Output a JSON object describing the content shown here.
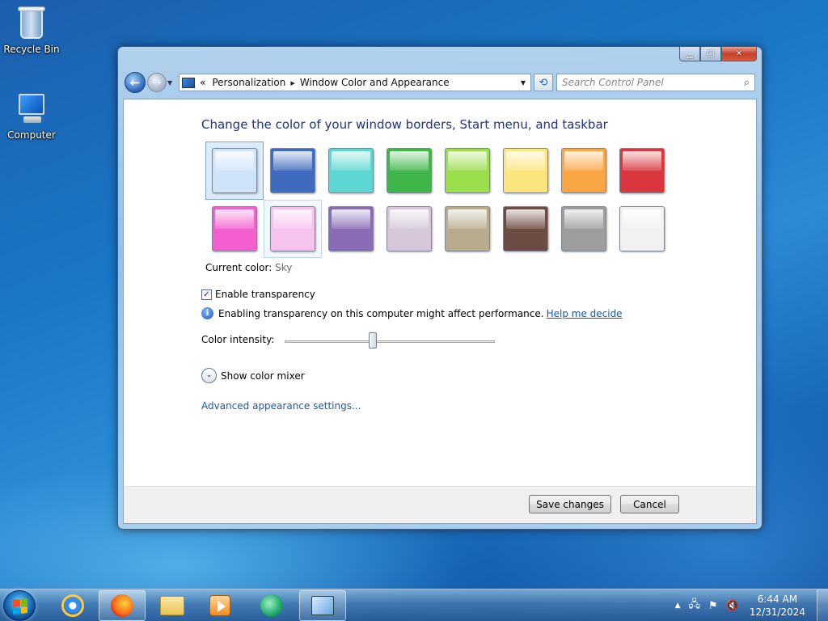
{
  "desktop": {
    "icons": [
      {
        "label": "Recycle Bin"
      },
      {
        "label": "Computer"
      }
    ]
  },
  "window": {
    "address": {
      "crumbs": [
        "Personalization",
        "Window Color and Appearance"
      ],
      "lead_sep": "«",
      "sep": "▸"
    },
    "search": {
      "placeholder": "Search Control Panel"
    },
    "heading": "Change the color of your window borders, Start menu, and taskbar",
    "colors": [
      {
        "name": "Sky",
        "hex": "#cfe4fb"
      },
      {
        "name": "Twilight",
        "hex": "#3f6bbf"
      },
      {
        "name": "Sea",
        "hex": "#5cd6d0"
      },
      {
        "name": "Leaf",
        "hex": "#3fb64a"
      },
      {
        "name": "Lime",
        "hex": "#9ade4c"
      },
      {
        "name": "Lemon",
        "hex": "#fbe57c"
      },
      {
        "name": "Pumpkin",
        "hex": "#fba645"
      },
      {
        "name": "Ruby",
        "hex": "#d9373d"
      },
      {
        "name": "Fuchsia",
        "hex": "#f45fcf"
      },
      {
        "name": "Blush",
        "hex": "#f6c3ef"
      },
      {
        "name": "Violet",
        "hex": "#8a6bb6"
      },
      {
        "name": "Lavender",
        "hex": "#d6c7da"
      },
      {
        "name": "Taupe",
        "hex": "#b8ab8e"
      },
      {
        "name": "Chocolate",
        "hex": "#6d4a42"
      },
      {
        "name": "Slate",
        "hex": "#9d9d9d"
      },
      {
        "name": "Frost",
        "hex": "#f1f1f1"
      }
    ],
    "current_color": {
      "label": "Current color:",
      "value": "Sky"
    },
    "transparency": {
      "label": "Enable transparency",
      "checked": true,
      "check_glyph": "✓"
    },
    "perf_note": {
      "text": "Enabling transparency on this computer might affect performance.",
      "link": "Help me decide"
    },
    "intensity": {
      "label": "Color intensity:",
      "value": 0.42
    },
    "mixer": {
      "label": "Show color mixer",
      "glyph": "⌄"
    },
    "advanced_link": "Advanced appearance settings...",
    "buttons": {
      "save": "Save changes",
      "cancel": "Cancel"
    }
  },
  "taskbar": {
    "apps": [
      {
        "name": "internet-explorer"
      },
      {
        "name": "firefox"
      },
      {
        "name": "windows-explorer"
      },
      {
        "name": "media-player"
      },
      {
        "name": "chat"
      },
      {
        "name": "control-panel"
      }
    ],
    "tray": {
      "expand": "▲",
      "time": "6:44 AM",
      "date": "12/31/2024"
    }
  }
}
